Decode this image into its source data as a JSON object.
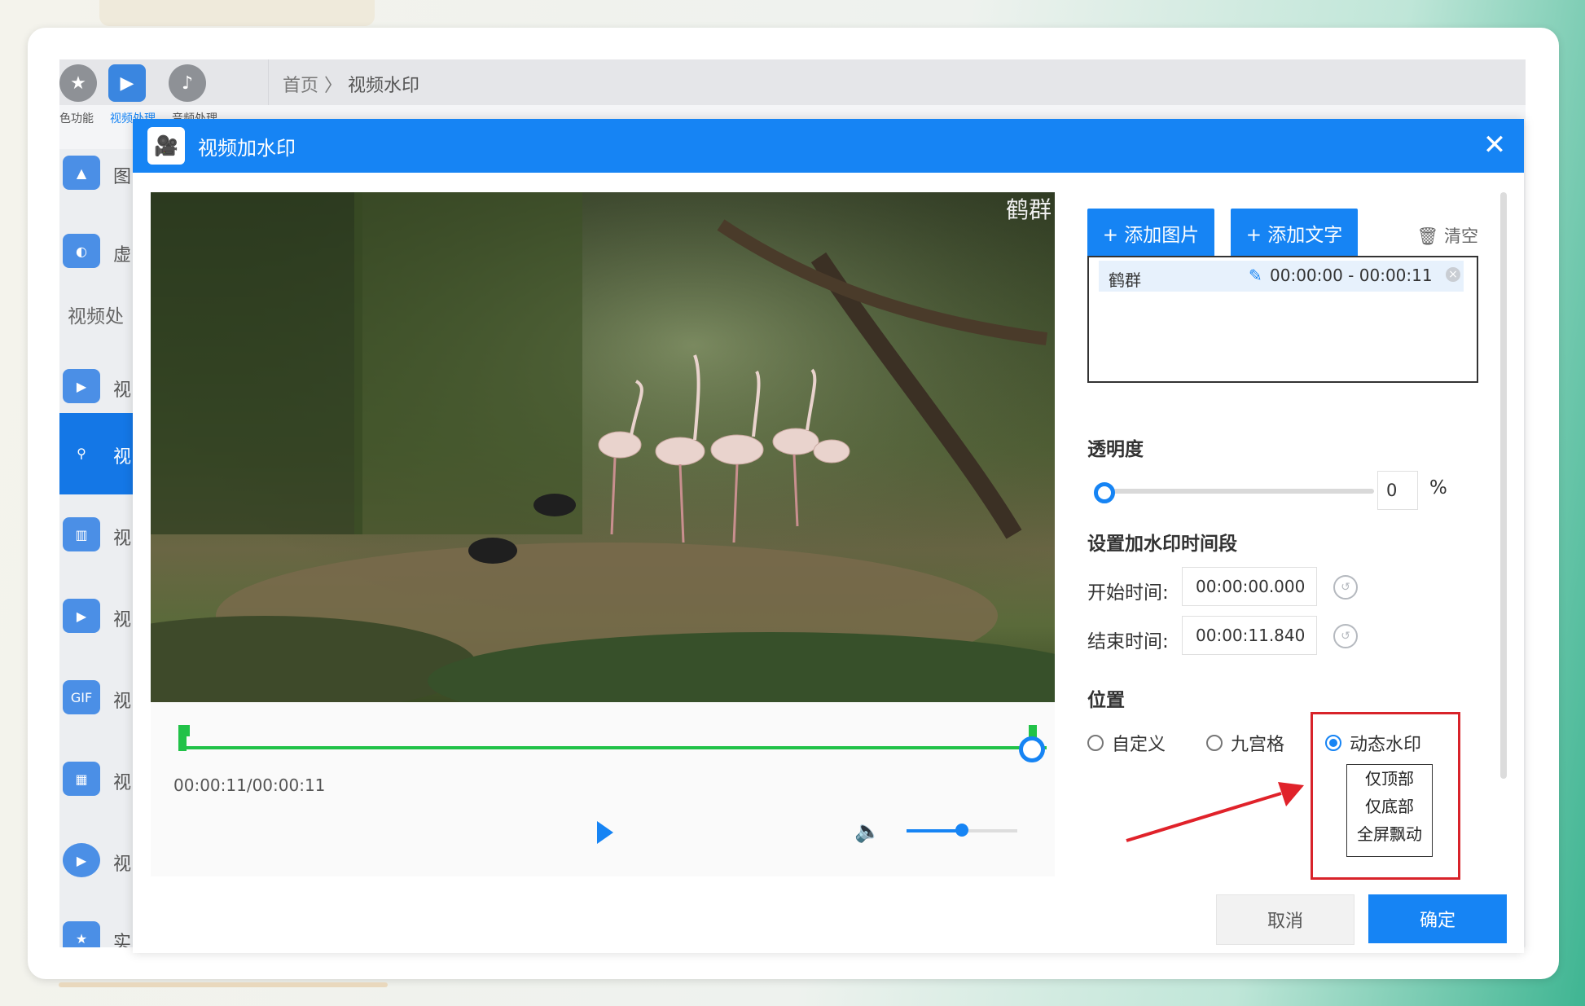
{
  "app": {
    "breadcrumb": {
      "home": "首页",
      "separator": "〉",
      "current": "视频水印"
    },
    "top_tabs": [
      {
        "label": "色功能"
      },
      {
        "label": "视频处理"
      },
      {
        "label": "音频处理"
      }
    ],
    "sidebar": {
      "items": [
        {
          "label": "图",
          "icon": "image-icon"
        },
        {
          "label": "虚",
          "icon": "blur-icon"
        },
        {
          "label": "视",
          "icon": "video-icon"
        },
        {
          "label": "视",
          "icon": "watermark-icon",
          "active": true
        },
        {
          "label": "视",
          "icon": "split-icon"
        },
        {
          "label": "视",
          "icon": "video-settings-icon"
        },
        {
          "label": "视",
          "icon": "gif-icon",
          "icon_text": "GIF"
        },
        {
          "label": "视",
          "icon": "webm-icon"
        },
        {
          "label": "视",
          "icon": "play-circle-icon"
        },
        {
          "label": "实",
          "icon": "star-icon"
        }
      ],
      "section_label": "视频处"
    }
  },
  "dialog": {
    "title": "视频加水印",
    "preview_overlay_text": "鹤群",
    "player": {
      "timecode": "00:00:11/00:00:11",
      "volume_fraction": 0.5,
      "progress_fraction": 1.0
    },
    "buttons": {
      "add_image": "+ 添加图片",
      "add_text": "+ 添加文字",
      "clear": "清空",
      "cancel": "取消",
      "confirm": "确定"
    },
    "watermarks": [
      {
        "name": "鹤群",
        "start": "00:00:00",
        "end": "00:00:11",
        "sep": " - "
      }
    ],
    "opacity": {
      "label": "透明度",
      "value": "0",
      "unit": "%"
    },
    "time_range": {
      "label": "设置加水印时间段",
      "start_label": "开始时间:",
      "start_value": "00:00:00.000",
      "end_label": "结束时间:",
      "end_value": "00:00:11.840"
    },
    "position": {
      "label": "位置",
      "options": [
        {
          "label": "自定义",
          "selected": false
        },
        {
          "label": "九宫格",
          "selected": false
        },
        {
          "label": "动态水印",
          "selected": true
        }
      ],
      "dynamic_submenu": [
        "仅顶部",
        "仅底部",
        "全屏飘动"
      ]
    }
  },
  "colors": {
    "accent": "#1684f4",
    "timeline": "#21c248",
    "annotation": "#d8232a"
  }
}
